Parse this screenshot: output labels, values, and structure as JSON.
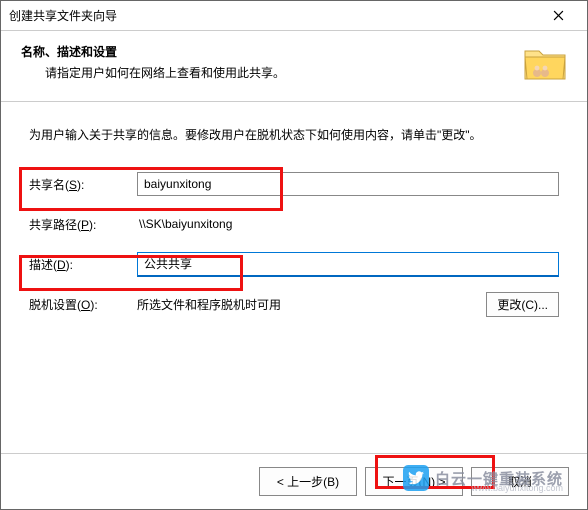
{
  "window": {
    "title": "创建共享文件夹向导"
  },
  "header": {
    "title": "名称、描述和设置",
    "subtitle": "请指定用户如何在网络上查看和使用此共享。"
  },
  "instruction": "为用户输入关于共享的信息。要修改用户在脱机状态下如何使用内容，请单击\"更改\"。",
  "form": {
    "share_name": {
      "label_pre": "共享名(",
      "key": "S",
      "label_post": "):",
      "value": "baiyunxitong"
    },
    "share_path": {
      "label_pre": "共享路径(",
      "key": "P",
      "label_post": "):",
      "value": "\\\\SK\\baiyunxitong"
    },
    "description": {
      "label_pre": "描述(",
      "key": "D",
      "label_post": "):",
      "value": "公共共享"
    },
    "offline": {
      "label_pre": "脱机设置(",
      "key": "O",
      "label_post": "):",
      "value": "所选文件和程序脱机时可用",
      "change_btn": "更改(C)..."
    }
  },
  "footer": {
    "back": "< 上一步(B)",
    "next": "下一页(N) >",
    "cancel": "取消"
  },
  "watermark": {
    "brand": "白云一键重装系统",
    "url": "www.baiyunxitong.com"
  }
}
